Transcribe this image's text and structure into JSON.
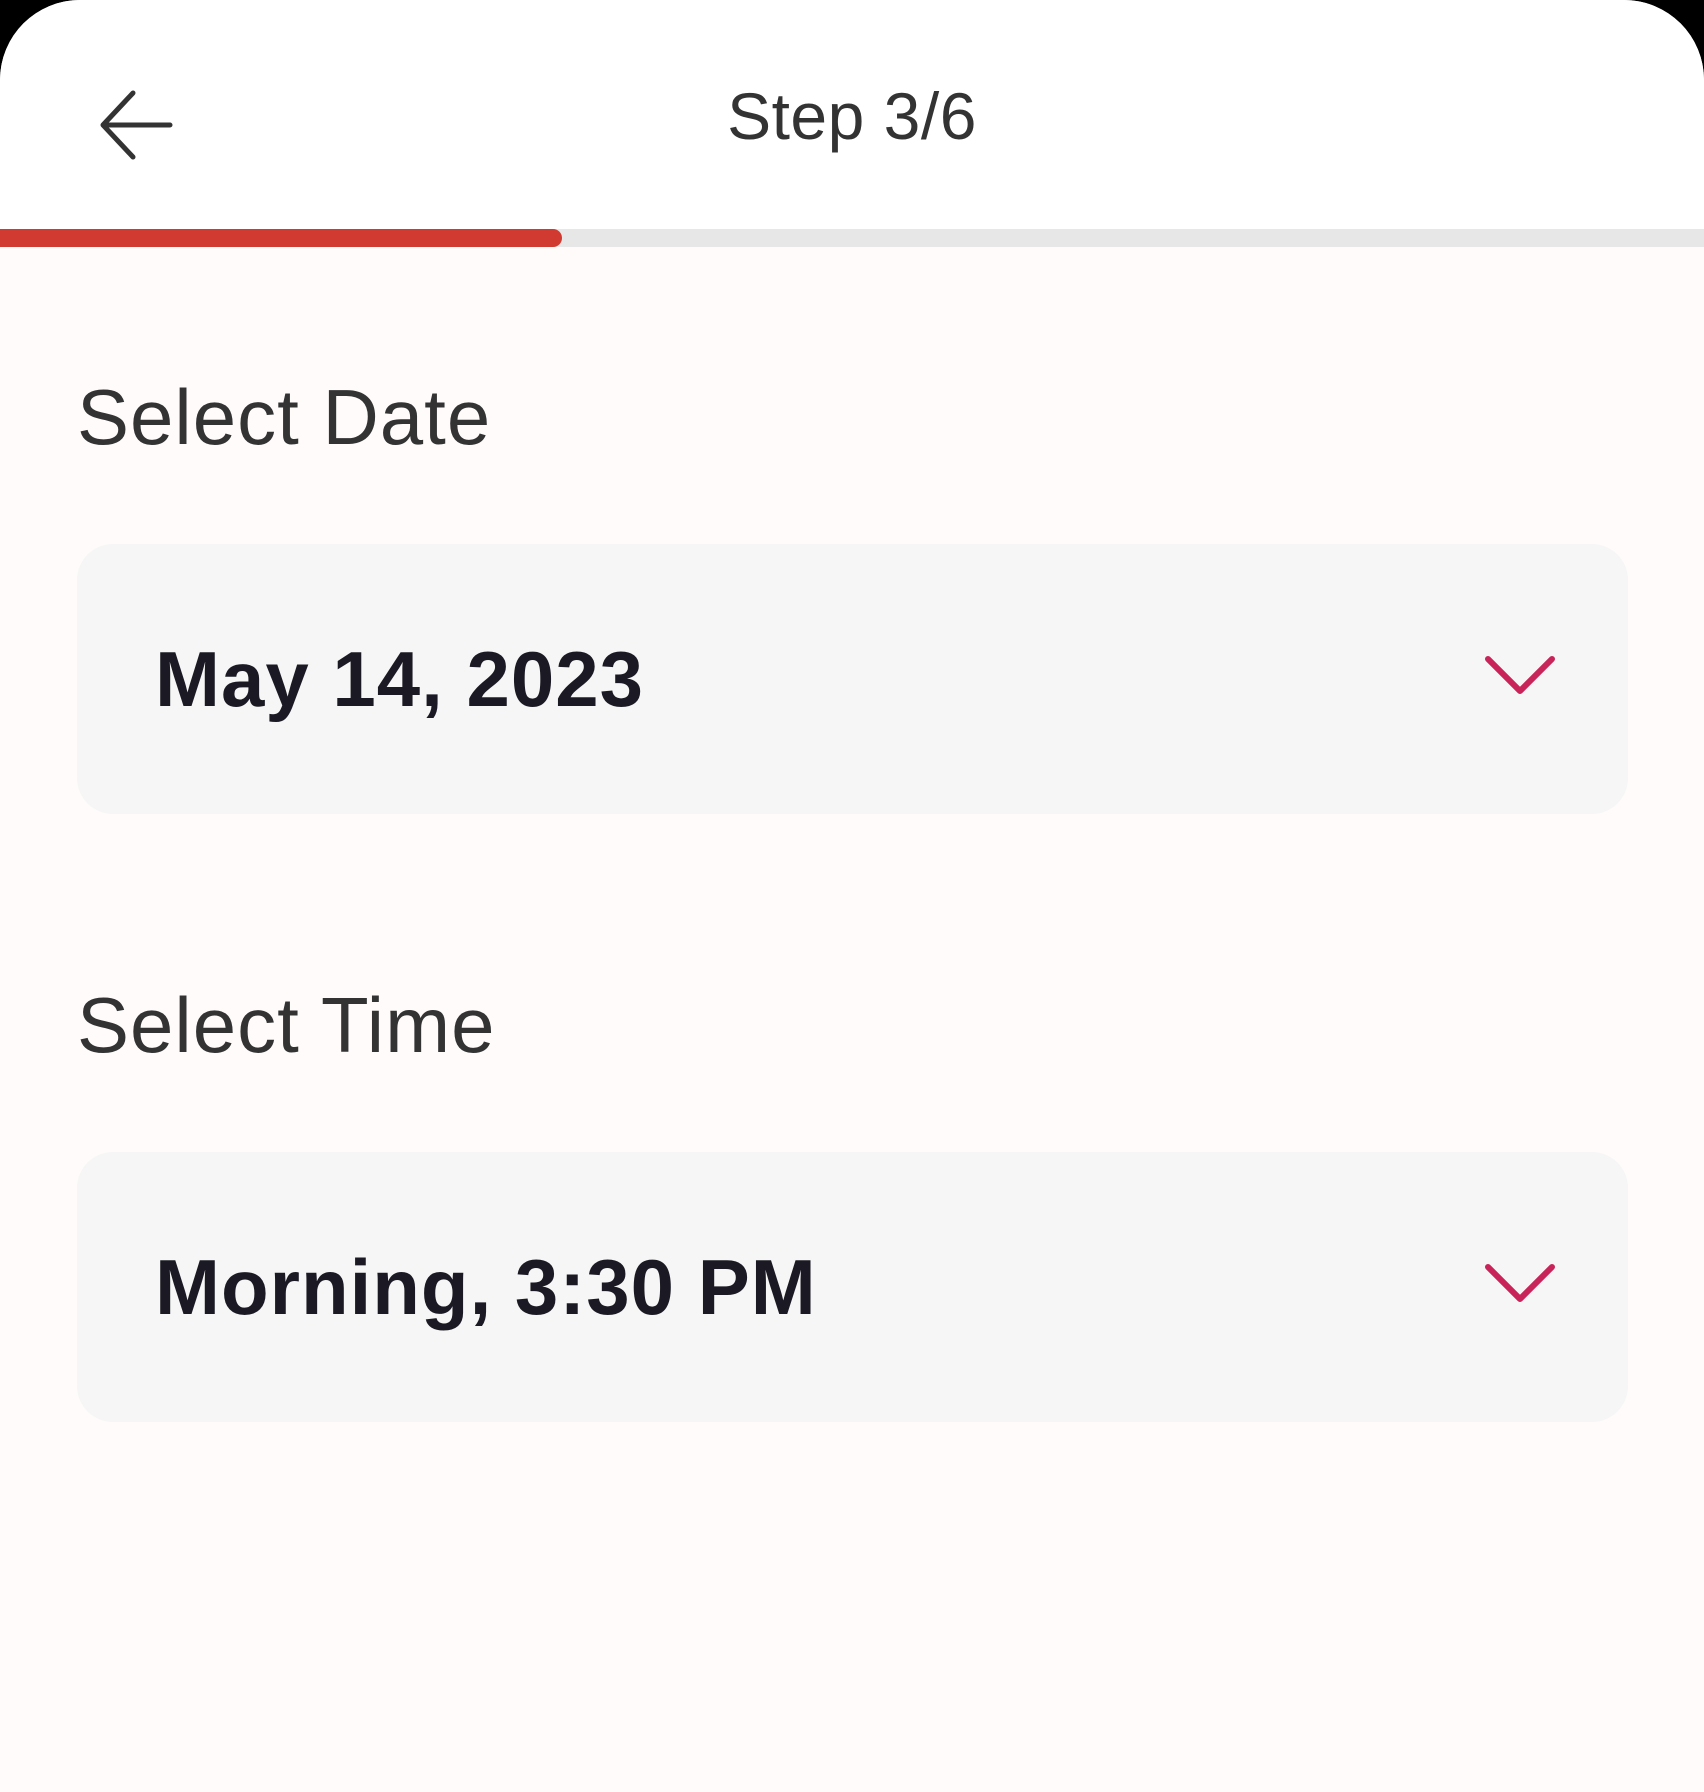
{
  "header": {
    "title": "Step 3/6",
    "back_icon": "arrow-left-icon"
  },
  "progress": {
    "current_step": 3,
    "total_steps": 6,
    "fraction": 0.33,
    "fill_color": "#d03a30",
    "track_color": "#e8e7e7"
  },
  "date_section": {
    "label": "Select Date",
    "value": "May 14, 2023",
    "chevron_icon": "chevron-down-icon"
  },
  "time_section": {
    "label": "Select Time",
    "value": "Morning, 3:30 PM",
    "chevron_icon": "chevron-down-icon"
  },
  "colors": {
    "accent": "#c8245a",
    "text_primary": "#1b1a24",
    "text_secondary": "#333333",
    "background": "#fffbfb",
    "field_background": "#f5f6f5"
  }
}
